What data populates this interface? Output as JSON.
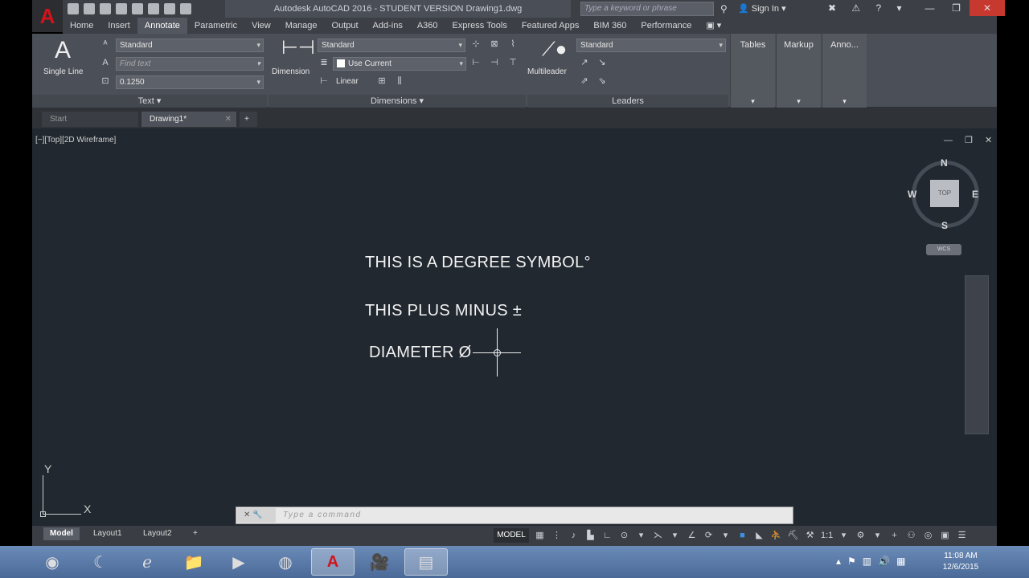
{
  "app": {
    "title": "Autodesk AutoCAD 2016 - STUDENT VERSION    Drawing1.dwg",
    "search_placeholder": "Type a keyword or phrase",
    "sign_in": "Sign In",
    "logo": "A",
    "brand_color": "#d3131b"
  },
  "menu_tabs": [
    "Home",
    "Insert",
    "Annotate",
    "Parametric",
    "View",
    "Manage",
    "Output",
    "Add-ins",
    "A360",
    "Express Tools",
    "Featured Apps",
    "BIM 360",
    "Performance"
  ],
  "active_tab": "Annotate",
  "ribbon": {
    "text": {
      "big_label": "Single Line",
      "style": "Standard",
      "find_placeholder": "Find text",
      "height": "0.1250",
      "panel": "Text ▾"
    },
    "dimensions": {
      "big_label": "Dimension",
      "style": "Standard",
      "layer": "Use Current",
      "type": "Linear",
      "panel": "Dimensions ▾"
    },
    "leaders": {
      "big_label": "Multileader",
      "style": "Standard",
      "panel": "Leaders"
    },
    "side_panels": [
      "Tables",
      "Markup",
      "Anno..."
    ]
  },
  "doc_tabs": {
    "start": "Start",
    "drawing": "Drawing1*",
    "add": "+"
  },
  "viewport": {
    "label": "[−][Top][2D Wireframe]",
    "controls": "— ❐ ✕",
    "lines": [
      "THIS IS A DEGREE SYMBOL°",
      "THIS PLUS MINUS ±",
      "DIAMETER Ø"
    ],
    "background": "#212830"
  },
  "viewcube": {
    "n": "N",
    "s": "S",
    "e": "E",
    "w": "W",
    "top": "TOP",
    "wcs": "WCS"
  },
  "ucs": {
    "x": "X",
    "y": "Y"
  },
  "command": {
    "placeholder": "Type a command",
    "left_icons": "✕ 🔧"
  },
  "layout_tabs": [
    "Model",
    "Layout1",
    "Layout2",
    "+"
  ],
  "status": {
    "model": "MODEL",
    "scale": "1:1"
  },
  "taskbar": {
    "time": "11:08 AM",
    "date": "12/6/2015"
  }
}
